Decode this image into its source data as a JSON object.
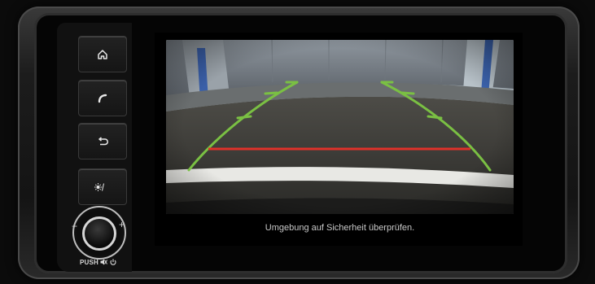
{
  "head_unit": {
    "buttons": [
      {
        "id": "home",
        "icon": "home-icon"
      },
      {
        "id": "phone",
        "icon": "phone-icon"
      },
      {
        "id": "back",
        "icon": "back-arrow-icon"
      },
      {
        "id": "day-night",
        "icon": "day-night-icon"
      }
    ],
    "knob": {
      "minus_label": "−",
      "plus_label": "+",
      "push_label": "PUSH"
    }
  },
  "rear_camera": {
    "guide_line_color": "#7ac043",
    "stop_line_color": "#e0312a",
    "status_message": "Umgebung auf Sicherheit überprüfen."
  }
}
